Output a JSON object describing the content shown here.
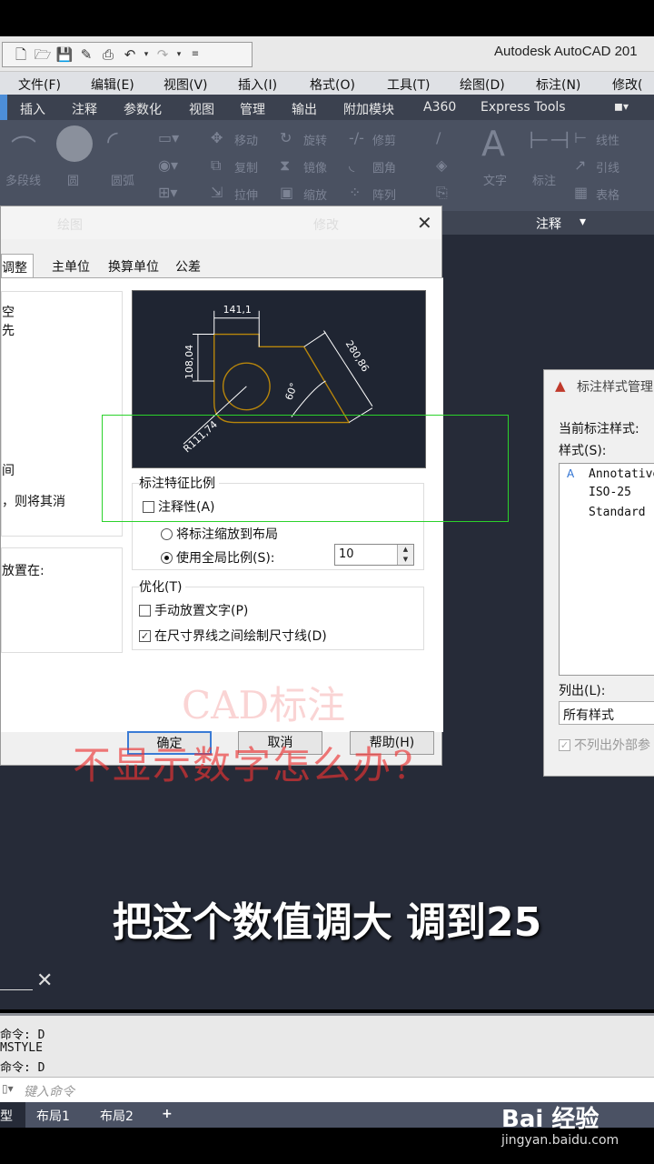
{
  "app": {
    "title": "Autodesk AutoCAD 201"
  },
  "menubar": [
    "文件(F)",
    "编辑(E)",
    "视图(V)",
    "插入(I)",
    "格式(O)",
    "工具(T)",
    "绘图(D)",
    "标注(N)",
    "修改("
  ],
  "ribbon_tabs": [
    "插入",
    "注释",
    "参数化",
    "视图",
    "管理",
    "输出",
    "附加模块",
    "A360",
    "Express Tools"
  ],
  "ribbon": {
    "draw": [
      "多段线",
      "圆",
      "圆弧"
    ],
    "modify": [
      "移动",
      "旋转",
      "修剪",
      "复制",
      "镜像",
      "圆角",
      "拉伸",
      "缩放",
      "阵列"
    ],
    "annotate": [
      "文字",
      "标注",
      "线性",
      "引线",
      "表格"
    ],
    "panels": {
      "draw": "绘图",
      "modify": "修改",
      "annotate": "注释"
    }
  },
  "dialog": {
    "tabs": [
      "调整",
      "主单位",
      "换算单位",
      "公差"
    ],
    "left_texts": [
      "空",
      "先",
      "间",
      "，则将其消",
      "放置在:"
    ],
    "preview": {
      "dim_top": "141,1",
      "dim_left": "108,04",
      "dim_slant": "280,86",
      "angle": "60°",
      "radius": "R111,74"
    },
    "feature_scale": {
      "title": "标注特征比例",
      "annotative": "注释性(A)",
      "scale_to_layout": "将标注缩放到布局",
      "use_overall": "使用全局比例(S):",
      "scale_value": "10"
    },
    "fine_tuning": {
      "title": "优化(T)",
      "manual_text": "手动放置文字(P)",
      "draw_dim_line": "在尺寸界线之间绘制尺寸线(D)"
    },
    "buttons": {
      "ok": "确定",
      "cancel": "取消",
      "help": "帮助(H)"
    }
  },
  "style_manager": {
    "title": "标注样式管理",
    "current_label": "当前标注样式:",
    "styles_label": "样式(S):",
    "styles": [
      "Annotative",
      "ISO-25",
      "Standard"
    ],
    "list_label": "列出(L):",
    "list_value": "所有样式",
    "exclude_xref": "不列出外部参"
  },
  "overlay": {
    "watermark_line1": "CAD标注",
    "watermark_line2": "不显示数字怎么办?",
    "subtitle": "把这个数值调大 调到25"
  },
  "command": {
    "history": [
      "命令: D",
      "MSTYLE",
      "命令: D"
    ],
    "placeholder": "键入命令"
  },
  "layout_tabs": [
    "型",
    "布局1",
    "布局2",
    "+"
  ],
  "brand": {
    "name": "Bai 经验",
    "url": "jingyan.baidu.com"
  }
}
